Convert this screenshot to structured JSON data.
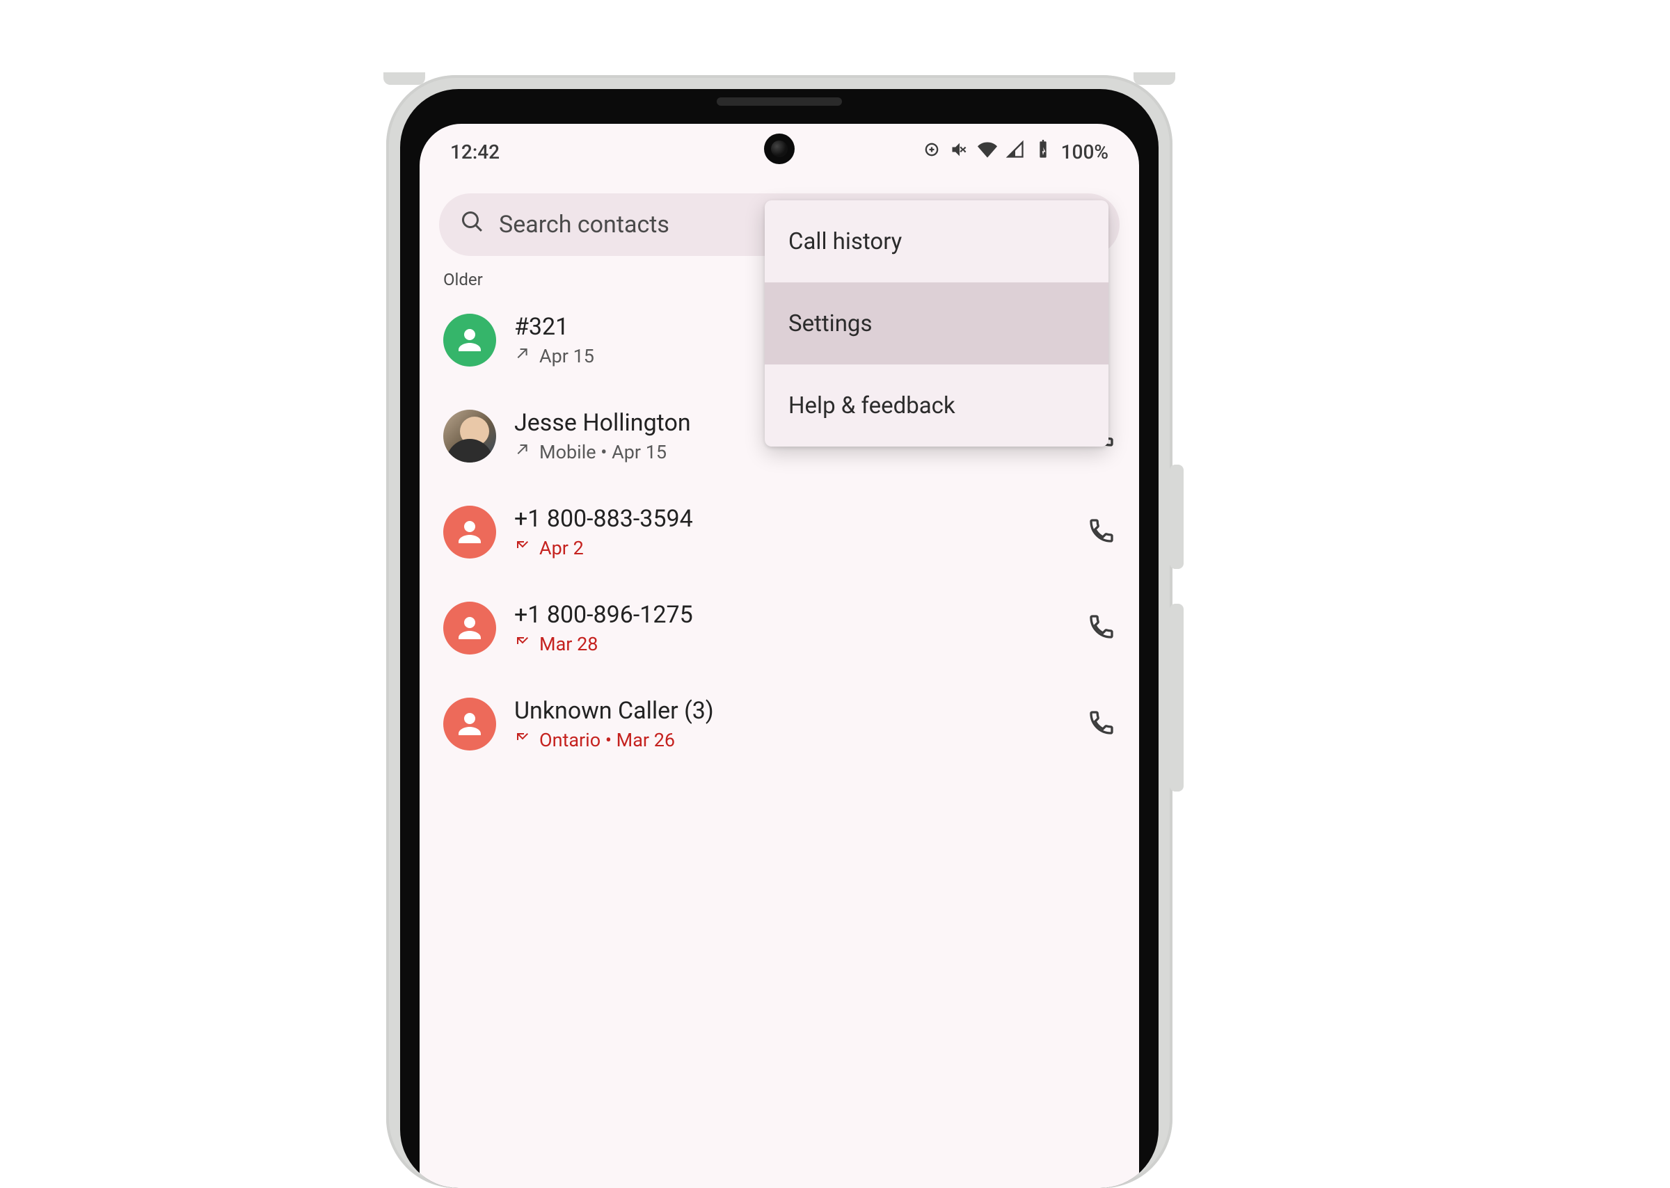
{
  "statusbar": {
    "time": "12:42",
    "battery": "100%"
  },
  "search": {
    "placeholder": "Search contacts"
  },
  "section_label": "Older",
  "menu": {
    "items": [
      {
        "label": "Call history"
      },
      {
        "label": "Settings"
      },
      {
        "label": "Help & feedback"
      }
    ],
    "highlighted_index": 1
  },
  "calls": [
    {
      "name": "#321",
      "direction": "outgoing",
      "meta_color": "gray",
      "meta_text": "Apr 15",
      "avatar": "green",
      "show_call_btn": false
    },
    {
      "name": "Jesse Hollington",
      "direction": "outgoing",
      "meta_color": "gray",
      "meta_text": "Mobile • Apr 15",
      "avatar": "photo",
      "show_call_btn": true
    },
    {
      "name": "+1 800-883-3594",
      "direction": "missed",
      "meta_color": "red",
      "meta_text": "Apr 2",
      "avatar": "red",
      "show_call_btn": true
    },
    {
      "name": "+1 800-896-1275",
      "direction": "missed",
      "meta_color": "red",
      "meta_text": "Mar 28",
      "avatar": "red",
      "show_call_btn": true
    },
    {
      "name": "Unknown Caller  (3)",
      "direction": "missed",
      "meta_color": "red",
      "meta_text": "Ontario • Mar 26",
      "avatar": "red",
      "show_call_btn": true
    }
  ]
}
